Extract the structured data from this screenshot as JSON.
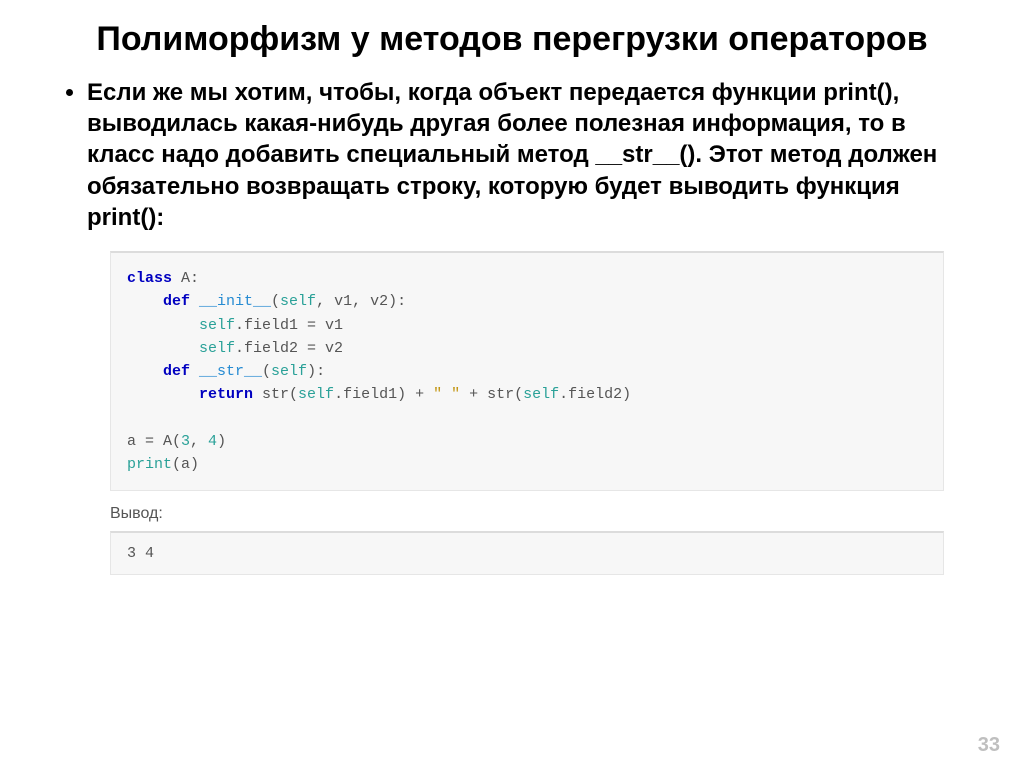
{
  "title": "Полиморфизм у методов перегрузки операторов",
  "paragraph": "Если же мы хотим, чтобы, когда объект передается функции print(), выводилась какая-нибудь другая более полезная информация, то в класс надо добавить специальный метод __str__(). Этот метод должен обязательно возвращать строку, которую будет выводить функция print():",
  "code": {
    "l1a": "class",
    "l1b": " A:",
    "l2a": "    def",
    "l2b": " __init__",
    "l2c": "(",
    "l2d": "self",
    "l2e": ", v1, v2):",
    "l3a": "        self",
    "l3b": ".field1 = v1",
    "l4a": "        self",
    "l4b": ".field2 = v2",
    "l5a": "    def",
    "l5b": " __str__",
    "l5c": "(",
    "l5d": "self",
    "l5e": "):",
    "l6a": "        return",
    "l6b": " str(",
    "l6c": "self",
    "l6d": ".field1) + ",
    "l6e": "\" \"",
    "l6f": " + str(",
    "l6g": "self",
    "l6h": ".field2)",
    "l7": "",
    "l8a": "a = A(",
    "l8b": "3",
    "l8c": ", ",
    "l8d": "4",
    "l8e": ")",
    "l9a": "print",
    "l9b": "(a)"
  },
  "output_label": "Вывод:",
  "output": "3 4",
  "page_number": "33"
}
